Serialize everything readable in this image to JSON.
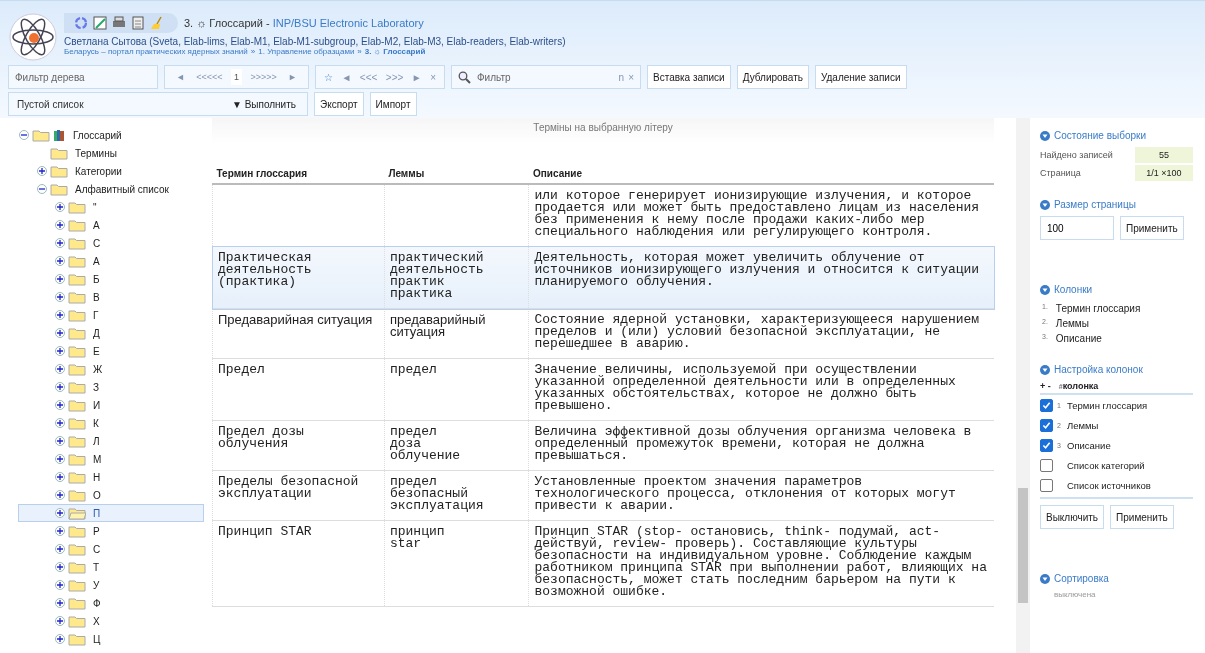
{
  "header": {
    "title_prefix": "3. ☼ Глоссарий - ",
    "title_link": "INP/BSU Electronic Laboratory",
    "user": "Светлана Сытова (Sveta, Elab-lims, Elab-M1, Elab-M1-subgroup, Elab-M2, Elab-M3, Elab-readers, Elab-writers)",
    "breadcrumb": [
      {
        "label": "Беларусь – портал практических ядерных знаний",
        "current": false
      },
      {
        "label": "1. Управление образцами",
        "current": false
      },
      {
        "label": "3. ☼ Глоссарий",
        "current": true
      }
    ],
    "separator": "»"
  },
  "toolbar": {
    "tree_filter": {
      "placeholder": "Фильтр дерева"
    },
    "pager": [
      {
        "label": "◄",
        "current": false
      },
      {
        "label": "<<<<<",
        "current": false
      },
      {
        "label": "1",
        "current": true
      },
      {
        "label": ">>>>>",
        "current": false
      },
      {
        "label": "►",
        "current": false
      }
    ],
    "nav": [
      "☆",
      "◄",
      "<<<",
      ">>>",
      "►",
      "×"
    ],
    "filter": {
      "placeholder": "Фильтр",
      "suffix": "n",
      "clear": "×"
    },
    "buttons": [
      "Вставка записи",
      "Дублировать",
      "Удаление записи"
    ],
    "list_select": {
      "value": "Пустой список",
      "action": "▼ Выполнить"
    },
    "buttons2": [
      "Экспорт",
      "Импорт"
    ]
  },
  "tree": [
    {
      "label": "Глоссарий",
      "expanded": true,
      "selected": false,
      "children": [
        {
          "label": "Термины",
          "selected": false
        },
        {
          "label": "Категории",
          "expanded": false,
          "selected": false
        },
        {
          "label": "Алфавитный список",
          "expanded": true,
          "selected": false,
          "children": [
            {
              "label": "\"",
              "expanded": false,
              "selected": false
            },
            {
              "label": "A",
              "expanded": false,
              "selected": false
            },
            {
              "label": "C",
              "expanded": false,
              "selected": false
            },
            {
              "label": "А",
              "expanded": false,
              "selected": false
            },
            {
              "label": "Б",
              "expanded": false,
              "selected": false
            },
            {
              "label": "В",
              "expanded": false,
              "selected": false
            },
            {
              "label": "Г",
              "expanded": false,
              "selected": false
            },
            {
              "label": "Д",
              "expanded": false,
              "selected": false
            },
            {
              "label": "Е",
              "expanded": false,
              "selected": false
            },
            {
              "label": "Ж",
              "expanded": false,
              "selected": false
            },
            {
              "label": "З",
              "expanded": false,
              "selected": false
            },
            {
              "label": "И",
              "expanded": false,
              "selected": false
            },
            {
              "label": "К",
              "expanded": false,
              "selected": false
            },
            {
              "label": "Л",
              "expanded": false,
              "selected": false
            },
            {
              "label": "М",
              "expanded": false,
              "selected": false
            },
            {
              "label": "Н",
              "expanded": false,
              "selected": false
            },
            {
              "label": "О",
              "expanded": false,
              "selected": false
            },
            {
              "label": "П",
              "expanded": false,
              "selected": true
            },
            {
              "label": "Р",
              "expanded": false,
              "selected": false
            },
            {
              "label": "С",
              "expanded": false,
              "selected": false
            },
            {
              "label": "Т",
              "expanded": false,
              "selected": false
            },
            {
              "label": "У",
              "expanded": false,
              "selected": false
            },
            {
              "label": "Ф",
              "expanded": false,
              "selected": false
            },
            {
              "label": "Х",
              "expanded": false,
              "selected": false
            },
            {
              "label": "Ц",
              "expanded": false,
              "selected": false
            }
          ]
        }
      ]
    }
  ],
  "table": {
    "caption": "Терміны на выбранную літеру",
    "columns": [
      "Термин глоссария",
      "Леммы",
      "Описание"
    ],
    "rows": [
      {
        "kind": "mono",
        "selected": false,
        "description": "или которое генерирует ионизирующие излучения, и которое продается или может быть предоставлено лицам из населения без применения к нему после продажи каких-либо мер специального наблюдения или регулирующего контроля."
      },
      {
        "kind": "mono",
        "selected": true,
        "term": "Практическая деятельность (практика)",
        "lemmas": [
          "практический",
          "деятельность",
          "практик",
          "практика"
        ],
        "description": "Деятельность, которая может увеличить облучение от источников ионизирующего излучения и относится к ситуации планируемого облучения."
      },
      {
        "kind": "sans",
        "selected": false,
        "term": "Предаварийная ситуация",
        "lemmas": [
          "предаварийный",
          "ситуация"
        ],
        "description": "Состояние ядерной установки, характеризующееся нарушением пределов и (или) условий безопасной эксплуатации, не перешедшее в аварию."
      },
      {
        "kind": "mono",
        "selected": false,
        "term": "Предел",
        "lemmas": [
          "предел"
        ],
        "description": "Значение величины, используемой при осуществлении указанной определенной деятельности или в определенных указанных обстоятельствах, которое не должно быть превышено."
      },
      {
        "kind": "mono",
        "selected": false,
        "term": "Предел дозы облучения",
        "lemmas": [
          "предел",
          "доза",
          "облучение"
        ],
        "description": "Величина эффективной дозы облучения организма человека в определенный промежуток времени, которая не должна превышаться."
      },
      {
        "kind": "mono",
        "selected": false,
        "term": "Пределы безопасной эксплуатации",
        "lemmas": [
          "предел",
          "безопасный",
          "эксплуатация"
        ],
        "description": "Установленные проектом значения параметров технологического процесса, отклонения от которых могут привести к аварии."
      },
      {
        "kind": "mono",
        "selected": false,
        "term": "Принцип STAR",
        "lemmas": [
          "принцип",
          "star"
        ],
        "description": "Принцип STAR (stop- остановись, think- подумай, act- действуй, review- проверь). Составляющие культуры безопасности на индивидуальном уровне. Соблюдение каждым работником принципа STAR при выполнении работ, влияющих на безопасность, может стать последним барьером на пути к возможной ошибке."
      }
    ]
  },
  "panel": {
    "state": {
      "title": "Состояние выборки",
      "found_label": "Найдено записей",
      "found": "55",
      "page_label": "Страница",
      "page": "1/1 ×100"
    },
    "page_size": {
      "title": "Размер страницы",
      "value": "100",
      "button": "Применить"
    },
    "columns": {
      "title": "Колонки",
      "items": [
        {
          "num": "1.",
          "label": "Термин глоссария"
        },
        {
          "num": "2.",
          "label": "Леммы"
        },
        {
          "num": "3.",
          "label": "Описание"
        }
      ]
    },
    "column_setup": {
      "title": "Настройка колонок",
      "head_toggle": "+ -",
      "head_num": "#",
      "head_label": "колонка",
      "items": [
        {
          "num": "1",
          "label": "Термин глоссария",
          "checked": true
        },
        {
          "num": "2",
          "label": "Леммы",
          "checked": true
        },
        {
          "num": "3",
          "label": "Описание",
          "checked": true
        },
        {
          "label": "Список категорий",
          "checked": false
        },
        {
          "label": "Список источников",
          "checked": false
        }
      ],
      "buttons": [
        "Выключить",
        "Применить"
      ]
    },
    "sort": {
      "title": "Сортировка",
      "value": "выключена"
    }
  }
}
